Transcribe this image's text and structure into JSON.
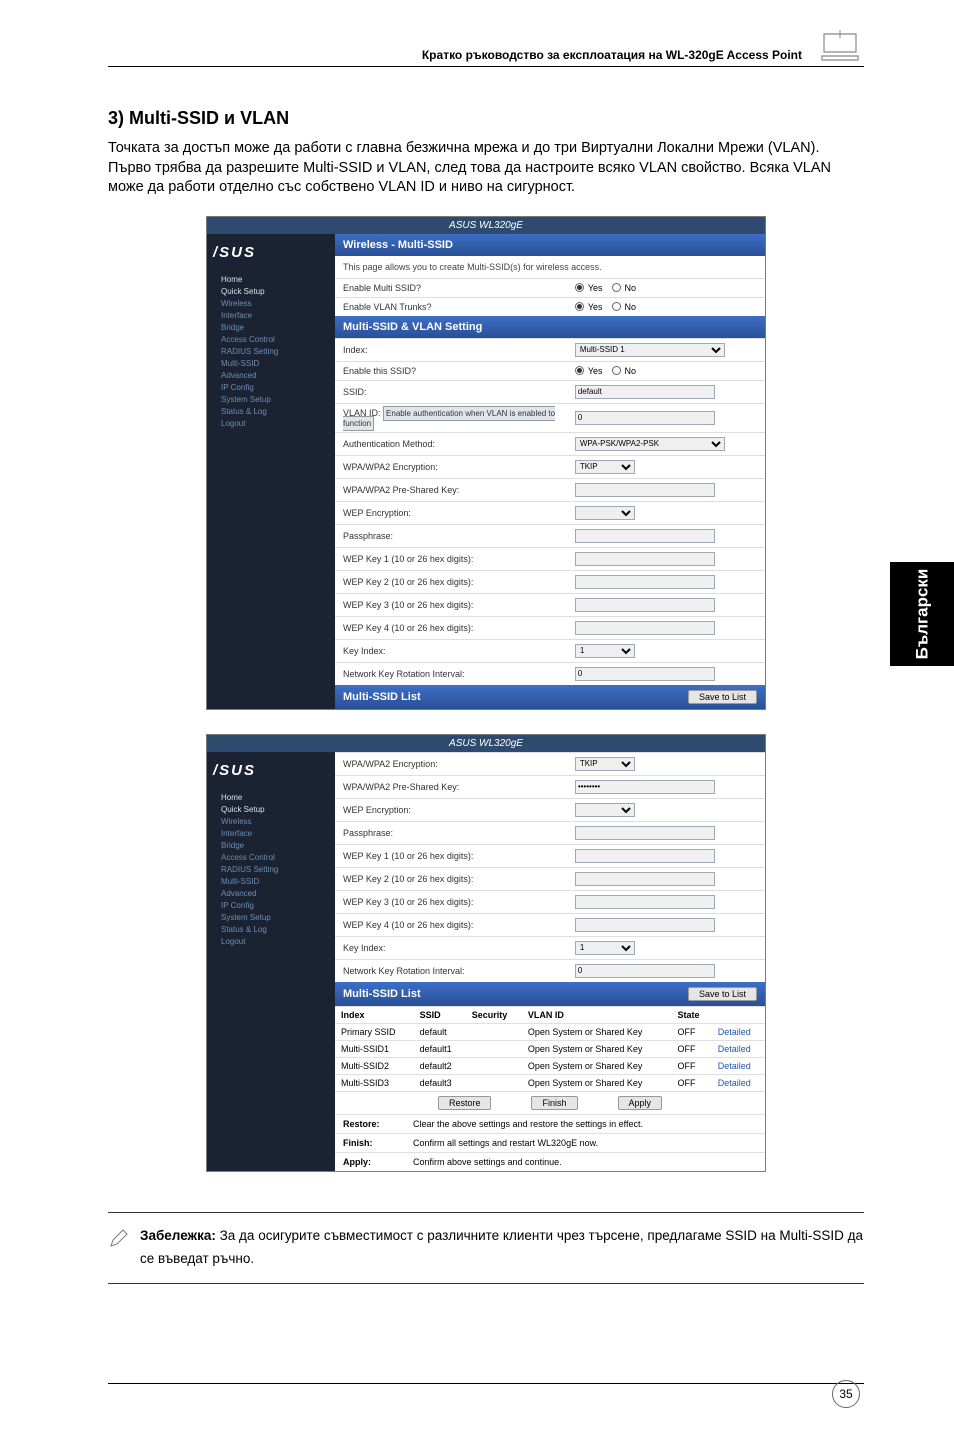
{
  "header": {
    "text": "Кратко ръководство за експлоатация на WL-320gE Access Point"
  },
  "sideTab": "Български",
  "section": {
    "title": "3) Multi-SSID и VLAN",
    "body": "Точката за достъп може да работи с главна безжична мрежа и до три Виртуални Локални Мрежи (VLAN). Първо трябва да разрешите Multi-SSID и VLAN, след това да настроите всяко VLAN свойство. Всяка VLAN може да работи отделно със собствено VLAN ID и ниво на сигурност."
  },
  "screenshot1": {
    "titlebar": "ASUS WL320gE",
    "logo": "/SUS",
    "sidebar": [
      "Home",
      "Quick Setup",
      "Wireless",
      "Interface",
      "Bridge",
      "Access Control",
      "RADIUS Setting",
      "Multi-SSID",
      "Advanced",
      "IP Config",
      "System Setup",
      "Status & Log",
      "Logout"
    ],
    "panelHead1": "Wireless - Multi-SSID",
    "desc": "This page allows you to create Multi-SSID(s) for wireless access.",
    "rows": [
      {
        "label": "Enable Multi SSID?",
        "val": {
          "type": "yesno",
          "yes": "Yes",
          "no": "No"
        }
      },
      {
        "label": "Enable VLAN Trunks?",
        "val": {
          "type": "yesno",
          "yes": "Yes",
          "no": "No"
        }
      }
    ],
    "panelHead2": "Multi-SSID & VLAN Setting",
    "rows2": [
      {
        "label": "Index:",
        "val": {
          "type": "select",
          "value": "Multi-SSID 1"
        }
      },
      {
        "label": "Enable this SSID?",
        "val": {
          "type": "yesno",
          "yes": "Yes",
          "no": "No"
        }
      },
      {
        "label": "SSID:",
        "val": {
          "type": "input",
          "value": "default"
        }
      },
      {
        "label": "VLAN ID:",
        "val": {
          "type": "input",
          "value": "0",
          "hint": "Enable authentication when VLAN is enabled to function"
        }
      },
      {
        "label": "Authentication Method:",
        "val": {
          "type": "select",
          "value": "WPA-PSK/WPA2-PSK"
        }
      },
      {
        "label": "WPA/WPA2 Encryption:",
        "val": {
          "type": "select",
          "value": "TKIP"
        }
      },
      {
        "label": "WPA/WPA2 Pre-Shared Key:",
        "val": {
          "type": "input",
          "value": ""
        }
      },
      {
        "label": "WEP Encryption:",
        "val": {
          "type": "select",
          "value": ""
        }
      },
      {
        "label": "Passphrase:",
        "val": {
          "type": "input",
          "value": ""
        }
      },
      {
        "label": "WEP Key 1 (10 or 26 hex digits):",
        "val": {
          "type": "input",
          "value": ""
        }
      },
      {
        "label": "WEP Key 2 (10 or 26 hex digits):",
        "val": {
          "type": "input",
          "value": ""
        }
      },
      {
        "label": "WEP Key 3 (10 or 26 hex digits):",
        "val": {
          "type": "input",
          "value": ""
        }
      },
      {
        "label": "WEP Key 4 (10 or 26 hex digits):",
        "val": {
          "type": "input",
          "value": ""
        }
      },
      {
        "label": "Key Index:",
        "val": {
          "type": "select",
          "value": "1"
        }
      },
      {
        "label": "Network Key Rotation Interval:",
        "val": {
          "type": "input",
          "value": "0"
        }
      }
    ],
    "panelHead3": "Multi-SSID List",
    "saveBtn": "Save to List"
  },
  "screenshot2": {
    "titlebar": "ASUS WL320gE",
    "logo": "/SUS",
    "sidebar": [
      "Home",
      "Quick Setup",
      "Wireless",
      "Interface",
      "Bridge",
      "Access Control",
      "RADIUS Setting",
      "Multi-SSID",
      "Advanced",
      "IP Config",
      "System Setup",
      "Status & Log",
      "Logout"
    ],
    "rowsTop": [
      {
        "label": "WPA/WPA2 Encryption:",
        "val": {
          "type": "select",
          "value": "TKIP"
        }
      },
      {
        "label": "WPA/WPA2 Pre-Shared Key:",
        "val": {
          "type": "password",
          "value": "********"
        }
      },
      {
        "label": "WEP Encryption:",
        "val": {
          "type": "select",
          "value": ""
        }
      },
      {
        "label": "Passphrase:",
        "val": {
          "type": "input",
          "value": ""
        }
      },
      {
        "label": "WEP Key 1 (10 or 26 hex digits):",
        "val": {
          "type": "input",
          "value": ""
        }
      },
      {
        "label": "WEP Key 2 (10 or 26 hex digits):",
        "val": {
          "type": "input",
          "value": ""
        }
      },
      {
        "label": "WEP Key 3 (10 or 26 hex digits):",
        "val": {
          "type": "input",
          "value": ""
        }
      },
      {
        "label": "WEP Key 4 (10 or 26 hex digits):",
        "val": {
          "type": "input",
          "value": ""
        }
      },
      {
        "label": "Key Index:",
        "val": {
          "type": "select",
          "value": "1"
        }
      },
      {
        "label": "Network Key Rotation Interval:",
        "val": {
          "type": "input",
          "value": "0"
        }
      }
    ],
    "panelHead": "Multi-SSID List",
    "saveBtn": "Save to List",
    "table": {
      "cols": [
        "Index",
        "SSID",
        "Security",
        "VLAN ID",
        "State",
        ""
      ],
      "rows": [
        [
          "Primary SSID",
          "default",
          "",
          "Open System or Shared Key",
          "OFF",
          "Detailed"
        ],
        [
          "Multi-SSID1",
          "default1",
          "",
          "Open System or Shared Key",
          "OFF",
          "Detailed"
        ],
        [
          "Multi-SSID2",
          "default2",
          "",
          "Open System or Shared Key",
          "OFF",
          "Detailed"
        ],
        [
          "Multi-SSID3",
          "default3",
          "",
          "Open System or Shared Key",
          "OFF",
          "Detailed"
        ]
      ]
    },
    "actionRow": {
      "restore": "Restore",
      "finish": "Finish",
      "apply": "Apply"
    },
    "foot": [
      {
        "k": "Restore:",
        "v": "Clear the above settings and restore the settings in effect."
      },
      {
        "k": "Finish:",
        "v": "Confirm all settings and restart WL320gE now."
      },
      {
        "k": "Apply:",
        "v": "Confirm above settings and continue."
      }
    ]
  },
  "note": {
    "label": "Забележка:",
    "text": "За да осигурите съвместимост с различните клиенти чрез търсене, предлагаме SSID на Multi-SSID да се въведат ръчно."
  },
  "pageNum": "35"
}
